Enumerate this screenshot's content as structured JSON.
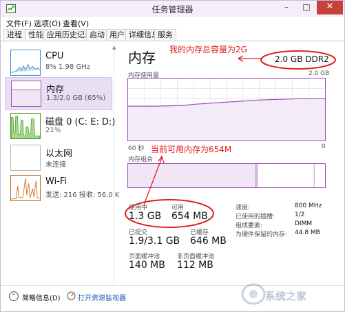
{
  "window": {
    "title": "任务管理器",
    "minimize": "–",
    "maximize": "□",
    "close": "✕"
  },
  "menu": [
    "文件(F)",
    "选项(O)",
    "查看(V)"
  ],
  "tabs": [
    "进程",
    "性能",
    "应用历史记录",
    "启动",
    "用户",
    "详细信息",
    "服务"
  ],
  "active_tab": "性能",
  "resources": [
    {
      "name": "CPU",
      "sub": "8% 1.98 GHz",
      "icon": "cpu-graph"
    },
    {
      "name": "内存",
      "sub": "1.3/2.0 GB (65%)",
      "icon": "memory-graph"
    },
    {
      "name": "磁盘 0 (C: E: D:)",
      "sub": "21%",
      "icon": "disk-graph"
    },
    {
      "name": "以太网",
      "sub": "未连接",
      "icon": "ethernet-graph"
    },
    {
      "name": "Wi-Fi",
      "sub": "发送: 216 接收: 56.0 K",
      "icon": "wifi-graph"
    }
  ],
  "memory": {
    "title": "内存",
    "capacity": "2.0 GB DDR2",
    "usage_label": "内存使用量",
    "usage_max": "2.0 GB",
    "axis_left": "60 秒",
    "axis_right": "0",
    "composition_label": "内存组合",
    "in_use_label": "使用中",
    "in_use": "1.3 GB",
    "available_label": "可用",
    "available": "654 MB",
    "committed_label": "已提交",
    "committed": "1.9/3.1 GB",
    "cached_label": "已缓存",
    "cached": "646 MB",
    "paged_pool_label": "页面缓冲池",
    "paged_pool": "140 MB",
    "nonpaged_pool_label": "非页面缓冲池",
    "nonpaged_pool": "112 MB",
    "details": [
      {
        "label": "速度:",
        "value": "800 MHz"
      },
      {
        "label": "已使用的插槽:",
        "value": "1/2"
      },
      {
        "label": "组成要素:",
        "value": "DIMM"
      },
      {
        "label": "为硬件保留的内存:",
        "value": "44.8 MB"
      }
    ],
    "in_use_fraction": 0.65
  },
  "annotations": {
    "capacity_note": "我的内存总容量为2G",
    "available_note": "当前可用内存为654M",
    "color": "#e01f1f"
  },
  "footer": {
    "fewer_details": "简略信息(D)",
    "open_monitor": "打开资源监视器"
  },
  "watermark": "系统之家",
  "colors": {
    "accent": "#9b4bb8",
    "selection": "#e8dff2",
    "close": "#c7413b",
    "link": "#1a55b8"
  }
}
